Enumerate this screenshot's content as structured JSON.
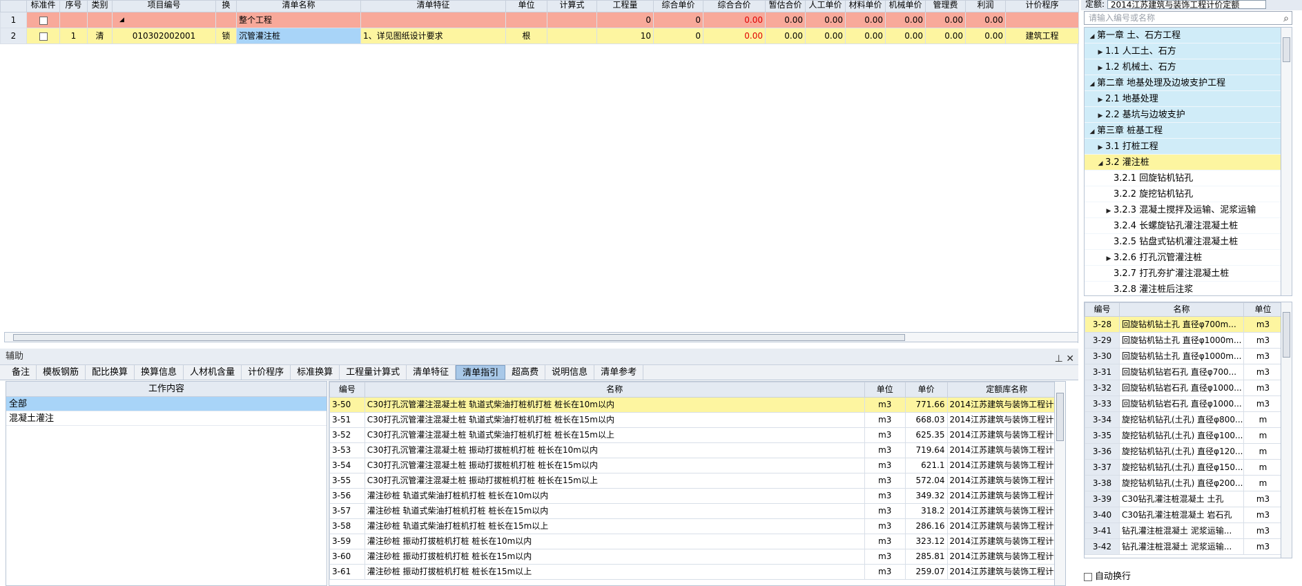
{
  "main": {
    "columns": [
      "",
      "标准件",
      "序号",
      "类别",
      "项目编号",
      "换",
      "清单名称",
      "清单特征",
      "单位",
      "计算式",
      "工程量",
      "综合单价",
      "综合合价",
      "暂估合价",
      "人工单价",
      "材料单价",
      "机械单价",
      "管理费",
      "利润",
      "计价程序"
    ],
    "rows": [
      {
        "rownum": "1",
        "seq": "",
        "type": "",
        "code": "◢",
        "swap": "",
        "name": "整个工程",
        "feature": "",
        "unit": "",
        "formula": "",
        "qty": "0",
        "unit_price": "0",
        "total": "0.00",
        "est": "0.00",
        "labor": "0.00",
        "material": "0.00",
        "machine": "0.00",
        "mgmt": "0.00",
        "profit": "0.00",
        "program": ""
      },
      {
        "rownum": "2",
        "seq": "1",
        "type": "清",
        "code": "010302002001",
        "swap": "锁",
        "name": "沉管灌注桩",
        "feature": "1、详见图纸设计要求",
        "unit": "根",
        "formula": "",
        "qty": "10",
        "unit_price": "0",
        "total": "0.00",
        "est": "0.00",
        "labor": "0.00",
        "material": "0.00",
        "machine": "0.00",
        "mgmt": "0.00",
        "profit": "0.00",
        "program": "建筑工程"
      }
    ]
  },
  "aux": {
    "title": "辅助",
    "controls": "⊥ ✕",
    "tabs": [
      "备注",
      "模板钢筋",
      "配比换算",
      "换算信息",
      "人材机含量",
      "计价程序",
      "标准换算",
      "工程量计算式",
      "清单特征",
      "清单指引",
      "超高费",
      "说明信息",
      "清单参考"
    ],
    "active_tab": "清单指引",
    "work_header": "工作内容",
    "work_items": [
      "全部",
      "混凝土灌注"
    ],
    "list_columns": [
      "编号",
      "名称",
      "单位",
      "单价",
      "定额库名称"
    ],
    "list_rows": [
      {
        "code": "3-50",
        "name": "C30打孔沉管灌注混凝土桩 轨道式柴油打桩机打桩 桩长在10m以内",
        "unit": "m3",
        "price": "771.66",
        "lib": "2014江苏建筑与装饰工程计价..."
      },
      {
        "code": "3-51",
        "name": "C30打孔沉管灌注混凝土桩 轨道式柴油打桩机打桩 桩长在15m以内",
        "unit": "m3",
        "price": "668.03",
        "lib": "2014江苏建筑与装饰工程计价..."
      },
      {
        "code": "3-52",
        "name": "C30打孔沉管灌注混凝土桩 轨道式柴油打桩机打桩 桩长在15m以上",
        "unit": "m3",
        "price": "625.35",
        "lib": "2014江苏建筑与装饰工程计价..."
      },
      {
        "code": "3-53",
        "name": "C30打孔沉管灌注混凝土桩 振动打拔桩机打桩 桩长在10m以内",
        "unit": "m3",
        "price": "719.64",
        "lib": "2014江苏建筑与装饰工程计价..."
      },
      {
        "code": "3-54",
        "name": "C30打孔沉管灌注混凝土桩 振动打拔桩机打桩 桩长在15m以内",
        "unit": "m3",
        "price": "621.1",
        "lib": "2014江苏建筑与装饰工程计价..."
      },
      {
        "code": "3-55",
        "name": "C30打孔沉管灌注混凝土桩 振动打拔桩机打桩 桩长在15m以上",
        "unit": "m3",
        "price": "572.04",
        "lib": "2014江苏建筑与装饰工程计价..."
      },
      {
        "code": "3-56",
        "name": "灌注砂桩 轨道式柴油打桩机打桩 桩长在10m以内",
        "unit": "m3",
        "price": "349.32",
        "lib": "2014江苏建筑与装饰工程计价..."
      },
      {
        "code": "3-57",
        "name": "灌注砂桩 轨道式柴油打桩机打桩 桩长在15m以内",
        "unit": "m3",
        "price": "318.2",
        "lib": "2014江苏建筑与装饰工程计价..."
      },
      {
        "code": "3-58",
        "name": "灌注砂桩 轨道式柴油打桩机打桩 桩长在15m以上",
        "unit": "m3",
        "price": "286.16",
        "lib": "2014江苏建筑与装饰工程计价..."
      },
      {
        "code": "3-59",
        "name": "灌注砂桩 振动打拔桩机打桩 桩长在10m以内",
        "unit": "m3",
        "price": "323.12",
        "lib": "2014江苏建筑与装饰工程计价..."
      },
      {
        "code": "3-60",
        "name": "灌注砂桩 振动打拔桩机打桩 桩长在15m以内",
        "unit": "m3",
        "price": "285.81",
        "lib": "2014江苏建筑与装饰工程计价..."
      },
      {
        "code": "3-61",
        "name": "灌注砂桩 振动打拔桩机打桩 桩长在15m以上",
        "unit": "m3",
        "price": "259.07",
        "lib": "2014江苏建筑与装饰工程计价..."
      }
    ]
  },
  "right": {
    "quota_label": "定额:",
    "quota_value": "2014江苏建筑与装饰工程计价定额",
    "search_placeholder": "请输入编号或名称",
    "tree": [
      {
        "label": "第一章 土、石方工程",
        "level": 0,
        "arrow": "◢",
        "kind": "folder"
      },
      {
        "label": "1.1 人工土、石方",
        "level": 1,
        "arrow": "▶",
        "kind": "folder"
      },
      {
        "label": "1.2 机械土、石方",
        "level": 1,
        "arrow": "▶",
        "kind": "folder"
      },
      {
        "label": "第二章 地基处理及边坡支护工程",
        "level": 0,
        "arrow": "◢",
        "kind": "folder"
      },
      {
        "label": "2.1 地基处理",
        "level": 1,
        "arrow": "▶",
        "kind": "folder"
      },
      {
        "label": "2.2 基坑与边坡支护",
        "level": 1,
        "arrow": "▶",
        "kind": "folder"
      },
      {
        "label": "第三章 桩基工程",
        "level": 0,
        "arrow": "◢",
        "kind": "folder"
      },
      {
        "label": "3.1 打桩工程",
        "level": 1,
        "arrow": "▶",
        "kind": "folder"
      },
      {
        "label": "3.2 灌注桩",
        "level": 1,
        "arrow": "◢",
        "kind": "selected"
      },
      {
        "label": "3.2.1 回旋钻机钻孔",
        "level": 2,
        "arrow": "",
        "kind": "leaf"
      },
      {
        "label": "3.2.2 旋挖钻机钻孔",
        "level": 2,
        "arrow": "",
        "kind": "leaf"
      },
      {
        "label": "3.2.3 混凝土搅拌及运输、泥浆运输",
        "level": 2,
        "arrow": "▶",
        "kind": "leaf"
      },
      {
        "label": "3.2.4 长螺旋钻孔灌注混凝土桩",
        "level": 2,
        "arrow": "",
        "kind": "leaf"
      },
      {
        "label": "3.2.5 钻盘式钻机灌注混凝土桩",
        "level": 2,
        "arrow": "",
        "kind": "leaf"
      },
      {
        "label": "3.2.6 打孔沉管灌注桩",
        "level": 2,
        "arrow": "▶",
        "kind": "leaf"
      },
      {
        "label": "3.2.7 打孔夯扩灌注混凝土桩",
        "level": 2,
        "arrow": "",
        "kind": "leaf"
      },
      {
        "label": "3.2.8 灌注桩后注浆",
        "level": 2,
        "arrow": "",
        "kind": "leaf"
      }
    ],
    "qlist_columns": [
      "编号",
      "名称",
      "单位"
    ],
    "qlist_rows": [
      {
        "code": "3-28",
        "name": "回旋钻机钻土孔 直径φ700m...",
        "unit": "m3"
      },
      {
        "code": "3-29",
        "name": "回旋钻机钻土孔 直径φ1000m...",
        "unit": "m3"
      },
      {
        "code": "3-30",
        "name": "回旋钻机钻土孔 直径φ1000m...",
        "unit": "m3"
      },
      {
        "code": "3-31",
        "name": "回旋钻机钻岩石孔 直径φ700...",
        "unit": "m3"
      },
      {
        "code": "3-32",
        "name": "回旋钻机钻岩石孔 直径φ1000...",
        "unit": "m3"
      },
      {
        "code": "3-33",
        "name": "回旋钻机钻岩石孔 直径φ1000...",
        "unit": "m3"
      },
      {
        "code": "3-34",
        "name": "旋挖钻机钻孔(土孔) 直径φ800...",
        "unit": "m"
      },
      {
        "code": "3-35",
        "name": "旋挖钻机钻孔(土孔) 直径φ100...",
        "unit": "m"
      },
      {
        "code": "3-36",
        "name": "旋挖钻机钻孔(土孔) 直径φ120...",
        "unit": "m"
      },
      {
        "code": "3-37",
        "name": "旋挖钻机钻孔(土孔) 直径φ150...",
        "unit": "m"
      },
      {
        "code": "3-38",
        "name": "旋挖钻机钻孔(土孔) 直径φ200...",
        "unit": "m"
      },
      {
        "code": "3-39",
        "name": "C30钻孔灌注桩混凝土 土孔",
        "unit": "m3"
      },
      {
        "code": "3-40",
        "name": "C30钻孔灌注桩混凝土 岩石孔",
        "unit": "m3"
      },
      {
        "code": "3-41",
        "name": "钻孔灌注桩混凝土 泥浆运输...",
        "unit": "m3"
      },
      {
        "code": "3-42",
        "name": "钻孔灌注桩混凝土 泥浆运输...",
        "unit": "m3"
      }
    ],
    "autowrap_label": "自动换行"
  }
}
